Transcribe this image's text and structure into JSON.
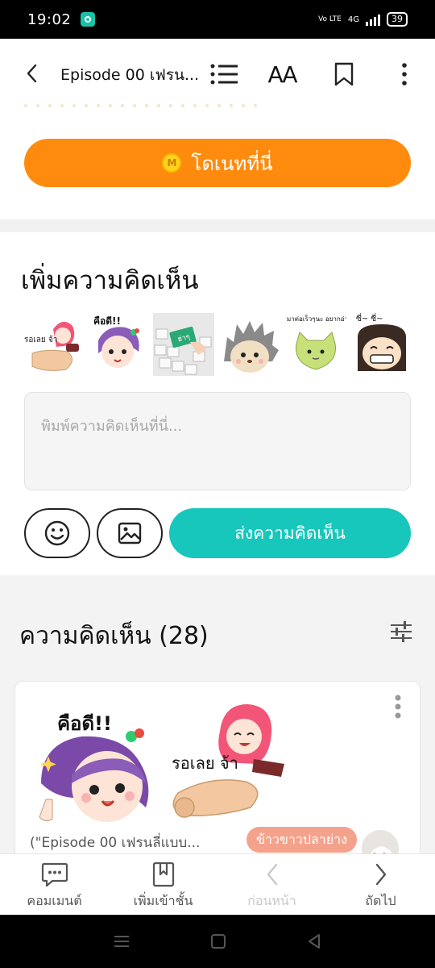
{
  "status_bar": {
    "time": "19:02",
    "network": "4G",
    "volte": "Vo LTE",
    "battery": "39"
  },
  "header": {
    "title": "Episode 00 เฟรน...",
    "font_button": "AA"
  },
  "donate": {
    "coin_symbol": "M",
    "label": "โดเนทที่นี่"
  },
  "add_comment": {
    "heading": "เพิ่มความคิดเห็น",
    "placeholder": "พิมพ์ความคิดเห็นที่นี่...",
    "send_label": "ส่งความคิดเห็น",
    "stickers": [
      {
        "name": "sticker-waiting",
        "caption": "รอเลย จ้า"
      },
      {
        "name": "sticker-good",
        "caption": "คือดี!!"
      },
      {
        "name": "sticker-keyboard",
        "caption": "ฮ่าๆ"
      },
      {
        "name": "sticker-hedgehog",
        "caption": ""
      },
      {
        "name": "sticker-cat",
        "caption": "มาต่อเร็วๆนะ อยากอ่านต่อ"
      },
      {
        "name": "sticker-smile",
        "caption": "ซี่~ ซี่~"
      }
    ]
  },
  "comments": {
    "heading": "ความคิดเห็น (28)",
    "items": [
      {
        "sticker_text_left": "คือดี!!",
        "sticker_text_right": "รอเลย จ้า",
        "source": "(\"Episode 00 เฟรนลี่แบบ...",
        "username": "ข้าวขาวปลาย่าง"
      }
    ]
  },
  "bottom_nav": {
    "comment": "คอมเมนต์",
    "add_shelf": "เพิ่มเข้าชั้น",
    "previous": "ก่อนหน้า",
    "next": "ถัดไป"
  },
  "colors": {
    "donate": "#ff8b0e",
    "send": "#17c7bc",
    "badge": "#f5a28c"
  }
}
